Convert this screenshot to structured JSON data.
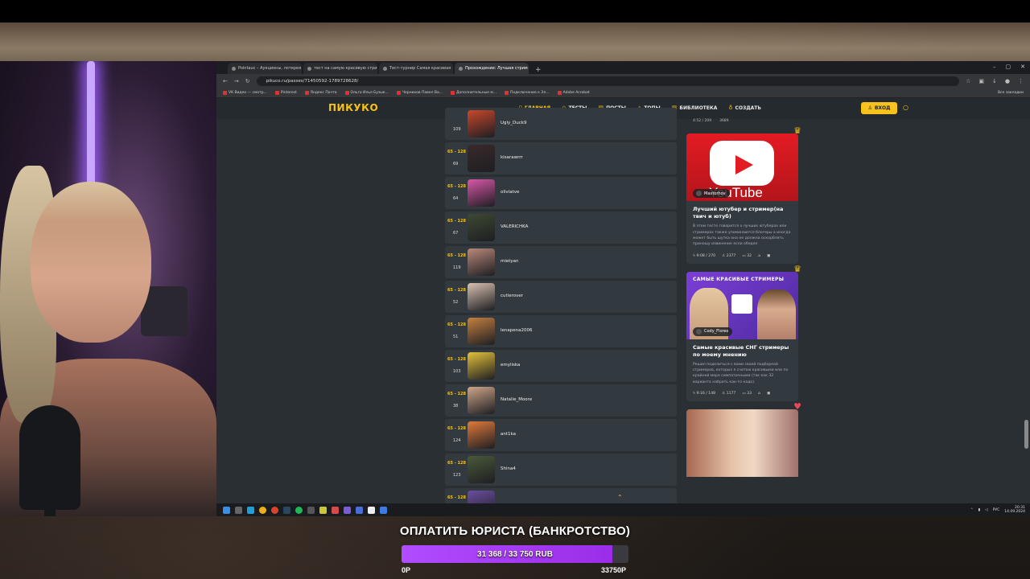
{
  "browser": {
    "tabs": [
      {
        "label": "Pointauc – Аукционы, лотерея",
        "active": false
      },
      {
        "label": "тест на самую красивую стри",
        "active": false
      },
      {
        "label": "Тест-турнир Самая красивая",
        "active": false
      },
      {
        "label": "Прохождение: Лучшая стрим",
        "active": true
      }
    ],
    "url": "pikuco.ru/passes/71450592-1789728628/",
    "bookmarks": [
      "VK Видео — смотр...",
      "Pinterest",
      "Яндекс Почта",
      "Ольга Илья Бузык...",
      "Черников Павел Ва...",
      "Дополнительные м...",
      "Подключение к Эл...",
      "Adobe Acrobat"
    ],
    "all_bookmarks": "Все закладки"
  },
  "site": {
    "logo": "ПИКУКО",
    "menu": [
      {
        "label": "ГЛАВНАЯ",
        "active": true,
        "icon": "home-icon"
      },
      {
        "label": "ТЕСТЫ",
        "active": false,
        "icon": "diamond-icon"
      },
      {
        "label": "ПОСТЫ",
        "active": false,
        "icon": "posts-icon"
      },
      {
        "label": "ТОПЫ",
        "active": false,
        "icon": "trophy-icon"
      },
      {
        "label": "БИБЛИОТЕКА",
        "active": false,
        "icon": "library-icon"
      },
      {
        "label": "СОЗДАТЬ",
        "active": false,
        "icon": "bulb-icon"
      }
    ],
    "login": "ВХОД"
  },
  "list": [
    {
      "range": "",
      "rank": "109",
      "name": "Ugly_Duck9",
      "color": "#c9472c"
    },
    {
      "range": "65 - 128",
      "rank": "69",
      "name": "kisarawrrr",
      "color": "#3a2a2a"
    },
    {
      "range": "65 - 128",
      "rank": "64",
      "name": "oliviatve",
      "color": "#d957a8"
    },
    {
      "range": "65 - 128",
      "rank": "67",
      "name": "VALERICHKA",
      "color": "#3d4a33"
    },
    {
      "range": "65 - 128",
      "rank": "119",
      "name": "mietyan",
      "color": "#b9897a"
    },
    {
      "range": "65 - 128",
      "rank": "52",
      "name": "cutierover",
      "color": "#d9c2b2"
    },
    {
      "range": "65 - 128",
      "rank": "51",
      "name": "lenapena2006",
      "color": "#c58040"
    },
    {
      "range": "65 - 128",
      "rank": "103",
      "name": "emyliska",
      "color": "#e4c23a"
    },
    {
      "range": "65 - 128",
      "rank": "38",
      "name": "Natalie_Moore",
      "color": "#cfa68a"
    },
    {
      "range": "65 - 128",
      "rank": "124",
      "name": "ant1ka",
      "color": "#e07a3a"
    },
    {
      "range": "65 - 128",
      "rank": "123",
      "name": "Shina4",
      "color": "#4a5a3a"
    },
    {
      "range": "65 - 128",
      "rank": "",
      "name": "",
      "color": "#6a4fa0"
    }
  ],
  "side": {
    "top_stats": [
      "4:52 / 209",
      "3689",
      ""
    ],
    "cards": [
      {
        "author": "Maxtorhov",
        "title": "Лучший ютубер и стример(на твич и ютуб)",
        "desc": "В этом тесте говорится о лучших ютуберах или стримерах также упоминаются блогеры а иногда может быть шутка она не должна оскорблять приношу извинение если обедел",
        "time": "9:08 / 270",
        "plays": "2377",
        "comments": "32",
        "thumb_word": "YouTube"
      },
      {
        "author": "Cody_Flores",
        "title": "Самые красивые СНГ стримеры по моему мнению",
        "desc": "Решил поделиться с вами своей подборкой стримеров, которых я считаю красивыми или по крайней мере симпатичными (так как 32 варианта набрать как-то надо).",
        "time": "9:16 / 148",
        "plays": "1177",
        "comments": "33",
        "thumb_title": "САМЫЕ КРАСИВЫЕ СТРИМЕРЫ"
      }
    ]
  },
  "taskbar": {
    "lang": "РУС",
    "time": "20:31",
    "date": "14.09.2024"
  },
  "goal": {
    "title": "ОПЛАТИТЬ ЮРИСТА (БАНКРОТСТВО)",
    "progress_text": "31 368 / 33 750 RUB",
    "progress_fraction": 0.929,
    "min": "0Р",
    "max": "33750Р"
  },
  "colors": {
    "accent": "#f6c21b",
    "goal_fill": "#b14cff",
    "site_bg": "#2a2f33"
  }
}
